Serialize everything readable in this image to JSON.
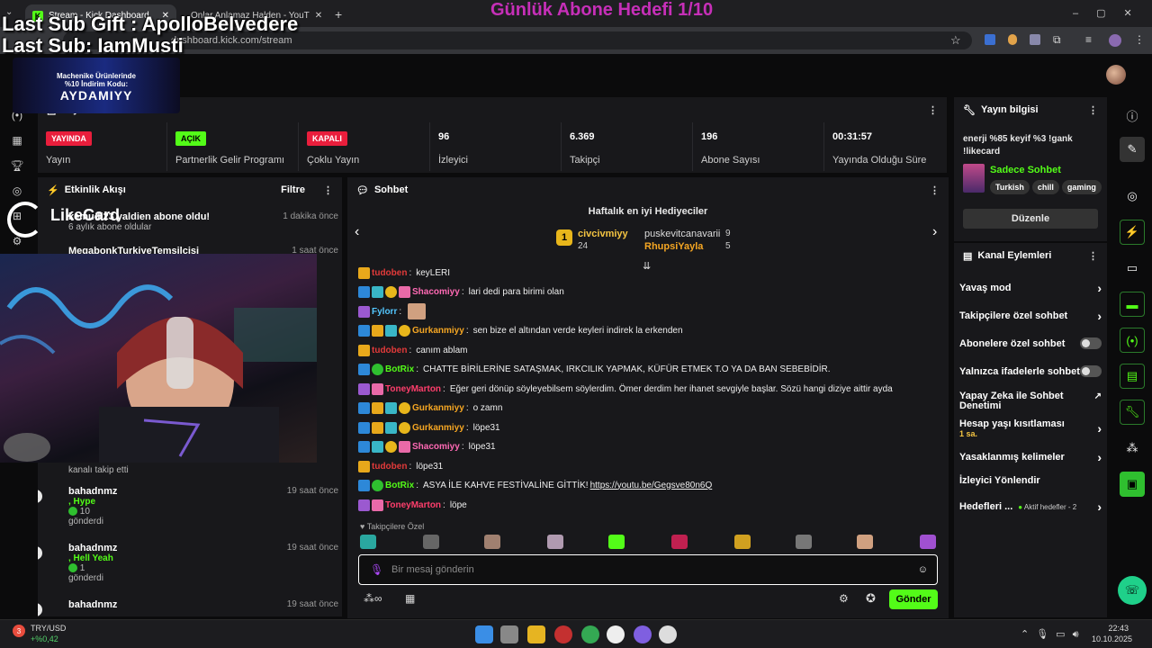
{
  "browser": {
    "tabs": [
      {
        "title": "Stream - Kick Dashboard"
      },
      {
        "title": "Onlar Anlamaz Halden - YouT"
      }
    ],
    "url": "dashboard.kick.com/stream"
  },
  "overlay": {
    "goal": "Günlük Abone Hedefi 1/10",
    "last_sub_gift": "Last Sub Gift : ApolloBelvedere",
    "last_sub": "Last Sub: IamMusti",
    "ad_line1": "Machenike Ürünlerinde",
    "ad_line2": "%10 İndirim Kodu:",
    "ad_code": "AYDAMIYY",
    "likecard": "LikeCard"
  },
  "stats": {
    "title": "Yayın İstatistikleri",
    "items": [
      {
        "badge": "YAYINDA",
        "label": "Yayın",
        "color": "#e91e3c"
      },
      {
        "badge": "AÇIK",
        "label": "Partnerlik Gelir Programı",
        "color": "#53fc18"
      },
      {
        "badge": "KAPALI",
        "label": "Çoklu Yayın",
        "color": "#e91e3c"
      },
      {
        "value": "96",
        "label": "İzleyici"
      },
      {
        "value": "6.369",
        "label": "Takipçi"
      },
      {
        "value": "196",
        "label": "Abone Sayısı"
      },
      {
        "value": "00:31:57",
        "label": "Yayında Olduğu Süre"
      }
    ]
  },
  "events": {
    "title": "Etkinlik Akışı",
    "filter": "Filtre",
    "items": [
      {
        "name": "kemudi23 yaldien abone oldu!",
        "sub": "6 aylık abone oldular",
        "time": "1 dakika önce"
      },
      {
        "name": "MegabonkTurkiyeTemsilcisi",
        "sub": "",
        "time": "1 saat önce"
      },
      {
        "name": "",
        "sub": "kanalı takip etti",
        "time": ""
      },
      {
        "name": "bahadnmz",
        "sub": ", Hype",
        "amount": "10",
        "tail": "gönderdi",
        "time": "19 saat önce"
      },
      {
        "name": "bahadnmz",
        "sub": ", Hell Yeah",
        "amount": "1",
        "tail": "gönderdi",
        "time": "19 saat önce"
      },
      {
        "name": "bahadnmz",
        "sub": "",
        "time": "19 saat önce"
      }
    ]
  },
  "chat": {
    "title": "Sohbet",
    "top_gifters_title": "Haftalık en iyi Hediyeciler",
    "gifters": [
      {
        "rank": "1",
        "name": "civcivmiyy",
        "count": "24"
      },
      {
        "name": "puskevitcanavarii",
        "count": "9"
      },
      {
        "name": "RhupsiYayla",
        "count": "5"
      }
    ],
    "messages": [
      {
        "user": "tudoben",
        "color": "#e23a3a",
        "text": "keyLERI",
        "badges": [
          "gold"
        ]
      },
      {
        "user": "Shacomiyy",
        "color": "#ff69b4",
        "text": "lari dedi para birimi olan",
        "badges": [
          "blue",
          "cyan",
          "coin",
          "pink"
        ]
      },
      {
        "user": "Fylorr",
        "color": "#53c7ff",
        "text": "",
        "badges": [
          "purple"
        ]
      },
      {
        "user": "Gurkanmiyy",
        "color": "#f5a623",
        "text": "sen bize el altından verde keyleri indirek la erkenden",
        "badges": [
          "blue",
          "gold",
          "cyan",
          "coin"
        ]
      },
      {
        "user": "tudoben",
        "color": "#e23a3a",
        "text": "canım ablam",
        "badges": [
          "gold"
        ]
      },
      {
        "user": "BotRix",
        "color": "#53fc18",
        "text": "CHATTE BİRİLERİNE SATAŞMAK, IRKCILIK YAPMAK, KÜFÜR ETMEK T.O YA DA BAN SEBEBİDİR.",
        "badges": [
          "blue",
          "green"
        ]
      },
      {
        "user": "ToneyMarton",
        "color": "#ff3e6c",
        "text": "Eğer geri dönüp söyleyebilsem söylerdim. Ömer derdim her ihanet sevgiyle başlar. Sözü hangi diziye aittir ayda",
        "badges": [
          "purple",
          "pink"
        ]
      },
      {
        "user": "Gurkanmiyy",
        "color": "#f5a623",
        "text": "o zamn",
        "badges": [
          "blue",
          "gold",
          "cyan",
          "coin"
        ]
      },
      {
        "user": "Gurkanmiyy",
        "color": "#f5a623",
        "text": "löpe31",
        "badges": [
          "blue",
          "gold",
          "cyan",
          "coin"
        ]
      },
      {
        "user": "Shacomiyy",
        "color": "#ff69b4",
        "text": "löpe31",
        "badges": [
          "blue",
          "cyan",
          "coin",
          "pink"
        ]
      },
      {
        "user": "tudoben",
        "color": "#e23a3a",
        "text": "löpe31",
        "badges": [
          "gold"
        ]
      },
      {
        "user": "BotRix",
        "color": "#53fc18",
        "text": "ASYA İLE KAHVE FESTİVALİNE GİTTİK! ",
        "link": "https://youtu.be/Gegsve80n6Q",
        "badges": [
          "blue",
          "green"
        ]
      },
      {
        "user": "ToneyMarton",
        "color": "#ff3e6c",
        "text": "löpe",
        "badges": [
          "purple",
          "pink"
        ]
      }
    ],
    "followers_only": "Takipçilere Özel",
    "placeholder": "Bir mesaj gönderin",
    "send": "Gönder"
  },
  "info": {
    "title": "Yayın bilgisi",
    "stream_title": "enerji %85 keyif %3 !gank !likecard",
    "category": "Sadece Sohbet",
    "tags": [
      "Turkish",
      "chill",
      "gaming"
    ],
    "edit": "Düzenle"
  },
  "kanal": {
    "title": "Kanal Eylemleri",
    "rows": [
      {
        "label": "Yavaş mod",
        "kind": "chev"
      },
      {
        "label": "Takipçilere özel sohbet",
        "kind": "chev"
      },
      {
        "label": "Abonelere özel sohbet",
        "kind": "toggle"
      },
      {
        "label": "Yalnızca ifadelerle sohbet",
        "kind": "toggle"
      },
      {
        "label": "Yapay Zeka ile Sohbet Denetimi",
        "kind": "ext"
      },
      {
        "label": "Hesap yaşı kısıtlaması",
        "sub": "1 sa.",
        "kind": "chev"
      },
      {
        "label": "Yasaklanmış kelimeler",
        "kind": "chev"
      },
      {
        "label": "İzleyici Yönlendir",
        "kind": "none"
      },
      {
        "label": "Hedefleri ...",
        "sub": "Aktif hedefler - 2",
        "kind": "chev"
      }
    ]
  },
  "taskbar": {
    "ticker": "TRY/USD",
    "change": "+%0,42",
    "badge": "3",
    "time": "22:43",
    "date": "10.10.2025"
  }
}
